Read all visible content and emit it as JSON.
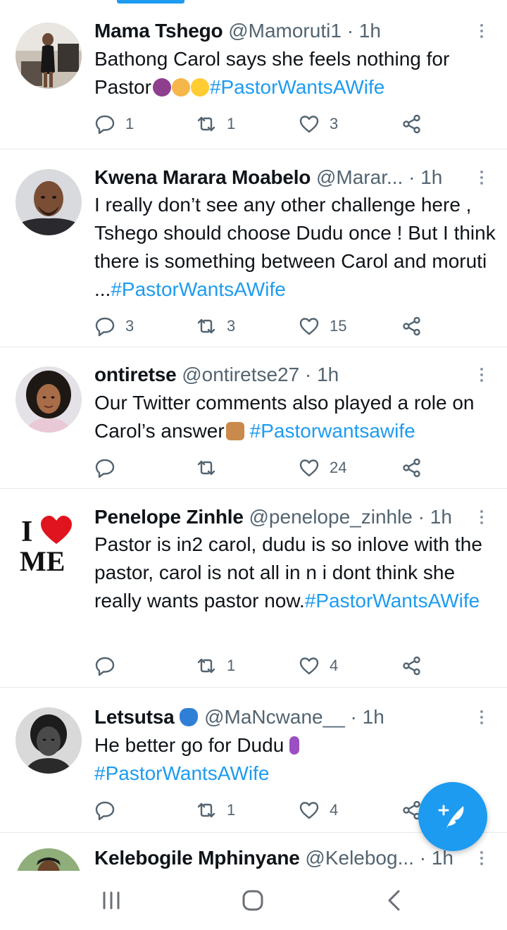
{
  "tweets": [
    {
      "name": "Mama Tshego",
      "handle": "@Mamoruti1",
      "time": "1h",
      "text": "Bathong Carol says she feels nothing for Pastor",
      "hashtag": "#PastorWantsAWife",
      "replies": "1",
      "retweets": "1",
      "likes": "3",
      "avatar": "woman-standing-office-photo"
    },
    {
      "name": "Kwena Marara Moabelo",
      "handle": "@Marar...",
      "time": "1h",
      "text": "I really don’t see any other challenge here , Tshego should choose Dudu once ! But I think there is something between Carol and moruti ...",
      "hashtag": "#PastorWantsAWife",
      "replies": "3",
      "retweets": "3",
      "likes": "15",
      "avatar": "bald-man-portrait-photo"
    },
    {
      "name": "ontiretse",
      "handle": "@ontiretse27",
      "time": "1h",
      "text": "Our Twitter comments also played a role on Carol’s answer",
      "hashtag": "#Pastorwantsawife",
      "replies": "",
      "retweets": "",
      "likes": "24",
      "avatar": "woman-curly-hair-photo"
    },
    {
      "name": "Penelope Zinhle",
      "handle": "@penelope_zinhle",
      "time": "1h",
      "text": "Pastor is in2 carol, dudu is so inlove with the pastor, carol is not all in n i dont think she really wants pastor now.",
      "hashtag": "#PastorWantsAWife",
      "replies": "",
      "retweets": "1",
      "likes": "4",
      "avatar": "i-love-me-logo",
      "avatar_text_top": "I",
      "avatar_text_bottom": "ME"
    },
    {
      "name": "Letsutsa",
      "handle": "@MaNcwane__",
      "time": "1h",
      "text": "He better go for Dudu",
      "hashtag": "#PastorWantsAWife",
      "replies": "",
      "retweets": "1",
      "likes": "4",
      "avatar": "woman-black-white-photo"
    },
    {
      "name": "Kelebogile Mphinyane",
      "handle": "@Kelebog...",
      "time": "1h",
      "avatar": "woman-outdoor-photo"
    }
  ],
  "separator_dot": "·",
  "compose_fab_icon": "feather-plus-icon",
  "nav": {
    "recents_icon": "recents-icon",
    "home_icon": "home-icon",
    "back_icon": "back-icon"
  },
  "colors": {
    "accent": "#1d9bf0",
    "text": "#0f1419",
    "secondary": "#536471",
    "divider": "#e6e9eb"
  }
}
